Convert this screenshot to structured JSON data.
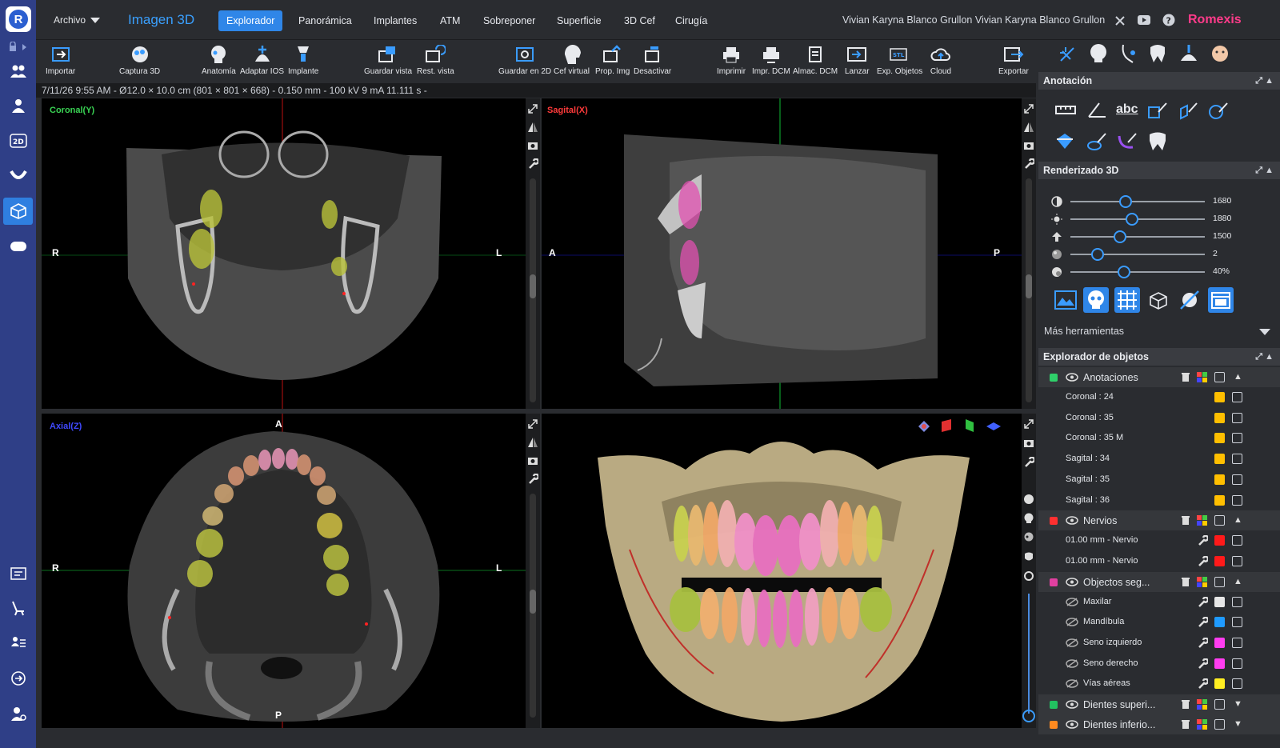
{
  "app": {
    "title": "Imagen 3D",
    "file_menu": "Archivo",
    "brand": "Romexis",
    "user": "Vivian Karyna Blanco Grullon Vivian Karyna Blanco Grullon"
  },
  "tabs": [
    "Explorador",
    "Panorámica",
    "Implantes",
    "ATM",
    "Sobreponer",
    "Superficie",
    "3D Cef",
    "Cirugía"
  ],
  "active_tab": "Explorador",
  "toolbar": [
    "Importar",
    "Captura 3D",
    "Anatomía",
    "Adaptar IOS",
    "Implante",
    "Guardar vista",
    "Rest. vista",
    "Guardar en 2D",
    "Cef virtual",
    "Prop. Img",
    "Desactivar",
    "Imprimir",
    "Impr. DCM",
    "Almac. DCM",
    "Lanzar",
    "Exp. Objetos",
    "Cloud",
    "Exportar"
  ],
  "info_line": "7/11/26 9:55 AM - Ø12.0 × 10.0 cm (801 × 801 × 668) - 0.150 mm - 100 kV 9 mA 11.111 s -",
  "views": {
    "coronal": {
      "label": "Coronal(Y)",
      "left": "R",
      "right": "L",
      "color": "#39d353"
    },
    "sagittal": {
      "label": "Sagital(X)",
      "left": "A",
      "right": "P",
      "color": "#ff3b3b"
    },
    "axial": {
      "label": "Axial(Z)",
      "top": "A",
      "bottom": "P",
      "left": "R",
      "right": "L",
      "color": "#3f49ff"
    }
  },
  "panel": {
    "annotation_title": "Anotación",
    "render_title": "Renderizado 3D",
    "sliders": [
      {
        "value": "1680",
        "level": 0.41
      },
      {
        "value": "1880",
        "level": 0.46
      },
      {
        "value": "1500",
        "level": 0.37
      },
      {
        "value": "2",
        "level": 0.2
      },
      {
        "value": "40%",
        "level": 0.4
      }
    ],
    "more_tools": "Más herramientas",
    "explorer_title": "Explorador de objetos",
    "groups": [
      {
        "name": "Anotaciones",
        "items": [
          {
            "name": "Coronal : 24",
            "color": "#ffbf00"
          },
          {
            "name": "Coronal : 35",
            "color": "#ffbf00"
          },
          {
            "name": "Coronal : 35 M",
            "color": "#ffbf00"
          },
          {
            "name": "Sagital : 34",
            "color": "#ffbf00"
          },
          {
            "name": "Sagital : 35",
            "color": "#ffbf00"
          },
          {
            "name": "Sagital : 36",
            "color": "#ffbf00"
          }
        ]
      },
      {
        "name": "Nervios",
        "items": [
          {
            "name": "01.00 mm - Nervio",
            "color": "#ff1a1a"
          },
          {
            "name": "01.00 mm - Nervio",
            "color": "#ff1a1a"
          }
        ]
      },
      {
        "name": "Objectos seg...",
        "items": [
          {
            "name": "Maxilar",
            "color": "#e6e6e6"
          },
          {
            "name": "Mandíbula",
            "color": "#1f9bff"
          },
          {
            "name": "Seno izquierdo",
            "color": "#ff3df0"
          },
          {
            "name": "Seno derecho",
            "color": "#ff3df0"
          },
          {
            "name": "Vías aéreas",
            "color": "#ffee22"
          }
        ]
      },
      {
        "name": "Dientes superi...",
        "items": []
      },
      {
        "name": "Dientes inferio...",
        "items": []
      }
    ]
  }
}
